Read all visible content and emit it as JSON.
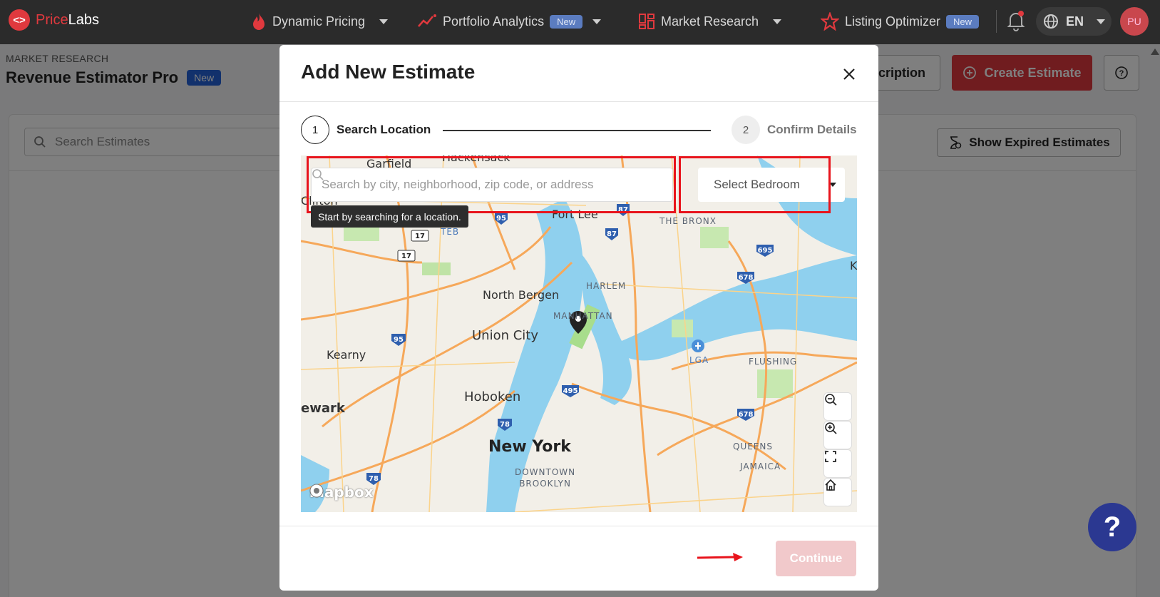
{
  "brand": {
    "name_part1": "Price",
    "name_part2": "Labs",
    "mark": "<>"
  },
  "nav": {
    "items": [
      {
        "label": "Dynamic Pricing",
        "icon": "flame-icon"
      },
      {
        "label": "Portfolio Analytics",
        "badge": "New",
        "icon": "chart-line-icon"
      },
      {
        "label": "Market Research",
        "icon": "grid-icon"
      },
      {
        "label": "Listing Optimizer",
        "badge": "New",
        "icon": "star-icon"
      }
    ],
    "language": "EN",
    "avatar_initials": "PU"
  },
  "page": {
    "breadcrumb": "MARKET RESEARCH",
    "title": "Revenue Estimator Pro",
    "title_badge": "New",
    "subscription_button": "scription",
    "create_button": "Create Estimate",
    "search_placeholder": "Search Estimates",
    "expired_button": "Show Expired Estimates"
  },
  "modal": {
    "title": "Add New Estimate",
    "steps": [
      {
        "number": "1",
        "label": "Search Location"
      },
      {
        "number": "2",
        "label": "Confirm Details"
      }
    ],
    "search_placeholder": "Search by city, neighborhood, zip code, or address",
    "bedroom_select": "Select Bedroom",
    "tooltip": "Start by searching for a location.",
    "continue_button": "Continue",
    "map_attribution": "mapbox"
  },
  "map_labels": {
    "garfield": "Garfield",
    "hackensack": "Hackensack",
    "clifton": "Clifton",
    "teb": "TEB",
    "fort_lee": "Fort Lee",
    "the_bronx": "THE BRONX",
    "north_bergen": "North Bergen",
    "harlem": "HARLEM",
    "manhattan": "MANHATTAN",
    "union_city": "Union City",
    "kearny": "Kearny",
    "lga": "LGA",
    "flushing": "FLUSHING",
    "newark": "ewark",
    "hoboken": "Hoboken",
    "new_york": "New York",
    "queens": "QUEENS",
    "jamaica": "JAMAICA",
    "downtown_brooklyn": "DOWNTOWN\nBROOKLYN",
    "k": "K",
    "shields": [
      "95",
      "17",
      "17",
      "87",
      "87",
      "695",
      "678",
      "95",
      "495",
      "78",
      "678",
      "78"
    ]
  },
  "colors": {
    "brand_red": "#e0393e",
    "nav_bg": "#2b2b2b",
    "highlight_red": "#e8141c",
    "fab": "#2b3891",
    "continue_disabled": "#f1c9cb"
  }
}
